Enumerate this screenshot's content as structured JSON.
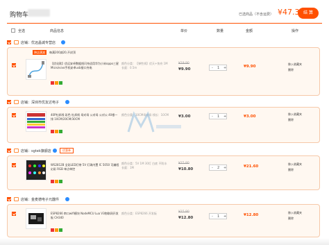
{
  "header": {
    "title": "购物车",
    "selected_label": "已选商品（不含运费）",
    "total": "¥47.30",
    "settle_label": "结 算"
  },
  "columns": {
    "select_all": "全选",
    "product_info": "商品信息",
    "unit_price": "单价",
    "quantity": "数量",
    "amount": "金额",
    "operation": "操作"
  },
  "shops": [
    {
      "name": "店铺：优远晶诚专营店",
      "coupon": "",
      "promo_tag": "跨店满减",
      "promo_text": "每满200减20,不封顶",
      "items": [
        {
          "name": "【优化款】优远安卓数据线闪充适用华为小米oppo三星Micro/vivo手机安卓usb接口充电",
          "spec": "颜色分类：【弹性线】优天+快充 1M  长度：0.5m",
          "old_price": "¥19.90",
          "price": "¥9.90",
          "qty": "1",
          "amount": "¥9.90",
          "ops": [
            "移入收藏夹",
            "删除"
          ]
        }
      ]
    },
    {
      "name": "店铺：深圳市优友达电子",
      "coupon": "",
      "promo_tag": "",
      "promo_text": "",
      "items": [
        {
          "name": "40P杜邦线 彩色 杜邦线 母对母 公对母 公对公 40根一排 10CM/20CM/30CM",
          "spec": "颜色分类：10CM母对母  线长：10CM",
          "old_price": "",
          "price": "¥3.00",
          "qty": "1",
          "amount": "¥3.00",
          "ops": [
            "移入收藏夹",
            "删除"
          ]
        }
      ]
    },
    {
      "name": "店铺：sgtek旗舰店",
      "coupon": "优惠券",
      "promo_tag": "",
      "promo_text": "",
      "items": [
        {
          "name": "WS2812B 全彩LED灯带 5V 灯珠内置 IC 5050 可编程 幻彩 RGB 单点单控",
          "spec": "颜色分类：5V 1M 30灯 白底 不防水  长度：1M",
          "old_price": "¥15.80",
          "price": "¥10.80",
          "qty": "2",
          "amount": "¥21.60",
          "ops": [
            "移入收藏夹",
            "删除"
          ]
        }
      ]
    },
    {
      "name": "店铺：金麦德电子元器件",
      "coupon": "",
      "promo_tag": "",
      "promo_text": "",
      "items": [
        {
          "name": "ESP8266 串口wifi模块 NodeMCU Lua V3物联网开发板 CH340",
          "spec": "颜色分类：ESP8266 开发板",
          "old_price": "¥15.80",
          "price": "¥12.80",
          "qty": "1",
          "amount": "¥12.80",
          "ops": [
            "移入收藏夹",
            "删除"
          ]
        }
      ]
    }
  ],
  "colors": {
    "accent": "#ff5000",
    "row_bg": "#fff8f1"
  }
}
